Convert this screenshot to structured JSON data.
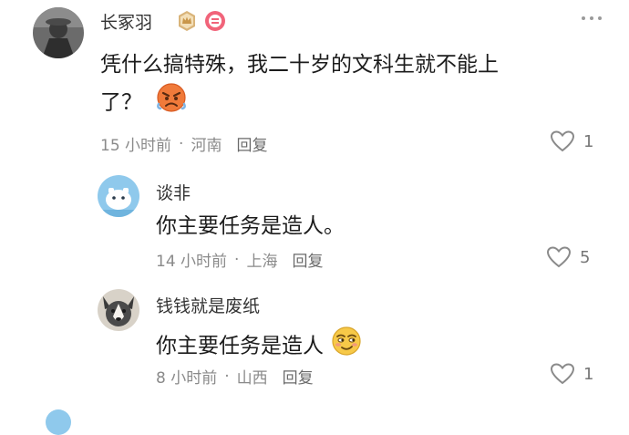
{
  "comments": [
    {
      "user": "长冢羽",
      "text_lines": [
        "凭什么搞特殊，我二十岁的文科生就不能上",
        "了？"
      ],
      "time": "15 小时前",
      "location": "河南",
      "reply_label": "回复",
      "likes": "1",
      "icons": [
        "rank-crown-badge",
        "fan-level-badge",
        "angry-face-emoji"
      ]
    },
    {
      "user": "谈非",
      "text_lines": [
        "你主要任务是造人。"
      ],
      "time": "14 小时前",
      "location": "上海",
      "reply_label": "回复",
      "likes": "5"
    },
    {
      "user": "钱钱就是废纸",
      "text_lines": [
        "你主要任务是造人"
      ],
      "time": "8 小时前",
      "location": "山西",
      "reply_label": "回复",
      "likes": "1",
      "icons": [
        "smirk-face-emoji"
      ]
    }
  ],
  "separator": "·",
  "colors": {
    "text": "#1c1c1c",
    "meta": "#8a8a8a",
    "angry_emoji": "#f07a3a",
    "smirk_emoji": "#f7c948"
  }
}
